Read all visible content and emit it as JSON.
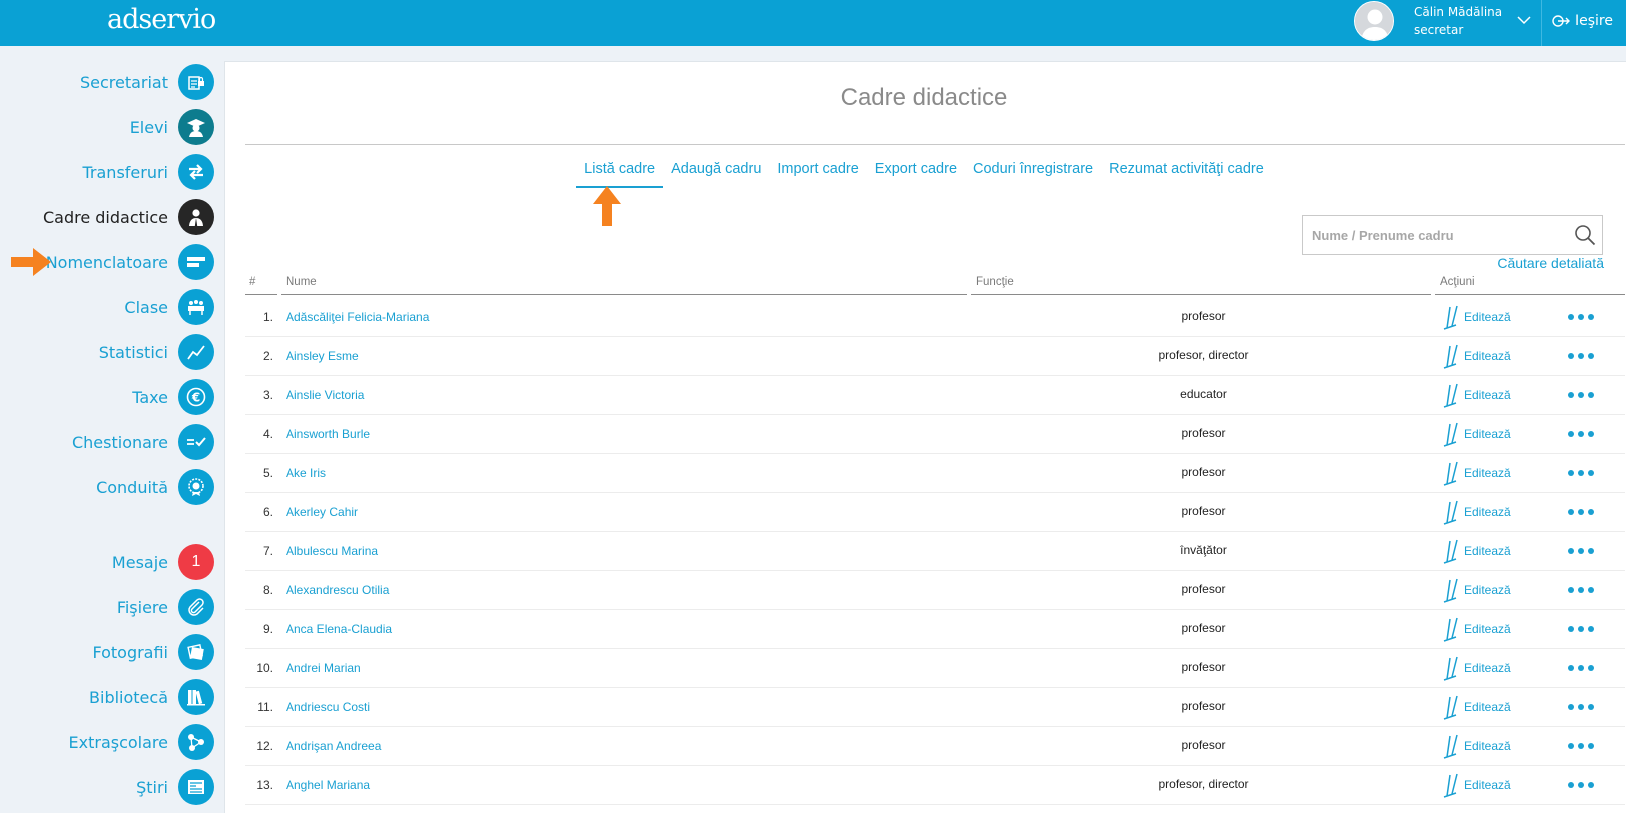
{
  "header": {
    "logo": "adservio",
    "user_name": "Călin Mădălina",
    "user_role": "secretar",
    "logout_label": "Ieşire",
    "bar_color": "#0aa1d4"
  },
  "sidebar": {
    "items": [
      {
        "label": "Secretariat",
        "icon": "certificate-lock-icon"
      },
      {
        "label": "Elevi",
        "icon": "graduate-icon"
      },
      {
        "label": "Transferuri",
        "icon": "transfer-arrows-icon"
      },
      {
        "label": "Cadre didactice",
        "icon": "teacher-icon",
        "active": true
      },
      {
        "label": "Nomenclatoare",
        "icon": "nomenclature-icon"
      },
      {
        "label": "Clase",
        "icon": "classroom-icon"
      },
      {
        "label": "Statistici",
        "icon": "chart-line-icon"
      },
      {
        "label": "Taxe",
        "icon": "euro-icon"
      },
      {
        "label": "Chestionare",
        "icon": "questionnaire-check-icon"
      },
      {
        "label": "Conduită",
        "icon": "medal-icon"
      },
      {
        "label": "Mesaje",
        "icon": "message-badge-icon",
        "badge": "1"
      },
      {
        "label": "Fişiere",
        "icon": "paperclip-icon"
      },
      {
        "label": "Fotografii",
        "icon": "photos-icon"
      },
      {
        "label": "Bibliotecă",
        "icon": "books-icon"
      },
      {
        "label": "Extraşcolare",
        "icon": "network-icon"
      },
      {
        "label": "Ştiri",
        "icon": "news-icon"
      }
    ]
  },
  "main": {
    "title": "Cadre didactice",
    "tabs": [
      {
        "label": "Listă cadre",
        "active": true
      },
      {
        "label": "Adaugă cadru"
      },
      {
        "label": "Import cadre"
      },
      {
        "label": "Export cadre"
      },
      {
        "label": "Coduri înregistrare"
      },
      {
        "label": "Rezumat activităţi cadre"
      }
    ],
    "search": {
      "placeholder": "Nume / Prenume cadru",
      "detail_link": "Căutare detaliată"
    },
    "table": {
      "headers": {
        "num": "#",
        "name": "Nume",
        "function": "Funcţie",
        "actions": "Acţiuni"
      },
      "edit_label": "Editează",
      "rows": [
        {
          "num": "1.",
          "name": "Adăscăliţei Felicia-Mariana",
          "function": "profesor"
        },
        {
          "num": "2.",
          "name": "Ainsley Esme",
          "function": "profesor, director"
        },
        {
          "num": "3.",
          "name": "Ainslie Victoria",
          "function": "educator"
        },
        {
          "num": "4.",
          "name": "Ainsworth Burle",
          "function": "profesor"
        },
        {
          "num": "5.",
          "name": "Ake Iris",
          "function": "profesor"
        },
        {
          "num": "6.",
          "name": "Akerley Cahir",
          "function": "profesor"
        },
        {
          "num": "7.",
          "name": "Albulescu Marina",
          "function": "învăţător"
        },
        {
          "num": "8.",
          "name": "Alexandrescu Otilia",
          "function": "profesor"
        },
        {
          "num": "9.",
          "name": "Anca Elena-Claudia",
          "function": "profesor"
        },
        {
          "num": "10.",
          "name": "Andrei Marian",
          "function": "profesor"
        },
        {
          "num": "11.",
          "name": "Andriescu Costi",
          "function": "profesor"
        },
        {
          "num": "12.",
          "name": "Andrişan Andreea",
          "function": "profesor"
        },
        {
          "num": "13.",
          "name": "Anghel Mariana",
          "function": "profesor, director"
        }
      ]
    }
  },
  "colors": {
    "accent": "#0aa1d4",
    "arrow": "#f58220",
    "badge": "#ef3b45",
    "active_icon": "#262626"
  }
}
